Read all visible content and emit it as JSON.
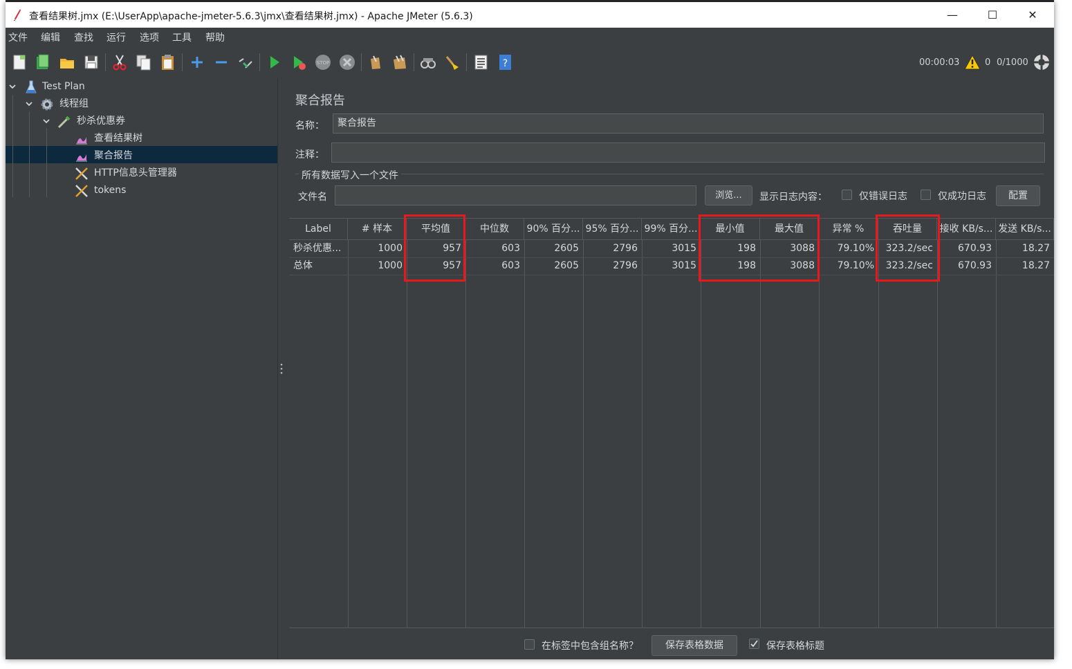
{
  "window": {
    "title": "查看结果树.jmx (E:\\UserApp\\apache-jmeter-5.6.3\\jmx\\查看结果树.jmx) - Apache JMeter (5.6.3)",
    "minimize": "—",
    "maximize": "☐",
    "close": "✕"
  },
  "menu": [
    "文件",
    "编辑",
    "查找",
    "运行",
    "选项",
    "工具",
    "帮助"
  ],
  "status": {
    "elapsed": "00:00:03",
    "warnings": "0",
    "threads": "0/1000"
  },
  "tree": {
    "items": [
      {
        "label": "Test Plan",
        "icon": "flask-icon"
      },
      {
        "label": "线程组",
        "icon": "gear-icon"
      },
      {
        "label": "秒杀优惠券",
        "icon": "pipette-icon"
      },
      {
        "label": "查看结果树",
        "icon": "chart-icon"
      },
      {
        "label": "聚合报告",
        "icon": "chart-icon"
      },
      {
        "label": "HTTP信息头管理器",
        "icon": "wrench-icon"
      },
      {
        "label": "tokens",
        "icon": "wrench-icon"
      }
    ]
  },
  "panel": {
    "title": "聚合报告",
    "name_label": "名称：",
    "name_value": "聚合报告",
    "comment_label": "注释：",
    "comment_value": "",
    "file_section": "所有数据写入一个文件",
    "filename_label": "文件名",
    "filename_value": "",
    "browse_button": "浏览...",
    "log_label": "显示日志内容：",
    "errors_only": "仅错误日志",
    "success_only": "仅成功日志",
    "config_button": "配置"
  },
  "table": {
    "headers": [
      "Label",
      "# 样本",
      "平均值",
      "中位数",
      "90% 百分...",
      "95% 百分...",
      "99% 百分...",
      "最小值",
      "最大值",
      "异常 %",
      "吞吐量",
      "接收 KB/s...",
      "发送 KB/s..."
    ],
    "rows": [
      [
        "秒杀优惠...",
        "1000",
        "957",
        "603",
        "2605",
        "2796",
        "3015",
        "198",
        "3088",
        "79.10%",
        "323.2/sec",
        "670.93",
        "18.27"
      ],
      [
        "总体",
        "1000",
        "957",
        "603",
        "2605",
        "2796",
        "3015",
        "198",
        "3088",
        "79.10%",
        "323.2/sec",
        "670.93",
        "18.27"
      ]
    ]
  },
  "footer": {
    "include_group": "在标签中包含组名称？",
    "save_data": "保存表格数据",
    "save_header": "保存表格标题",
    "save_header_checked": true
  }
}
